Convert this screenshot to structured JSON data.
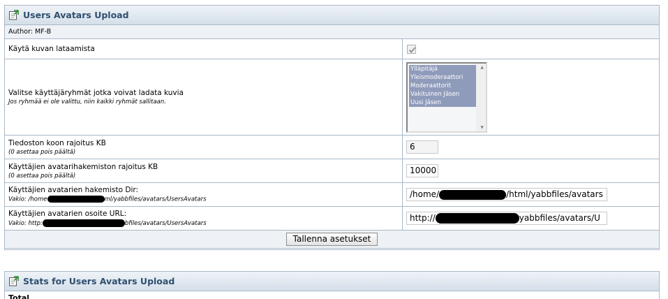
{
  "panel1": {
    "title": "Users Avatars Upload",
    "author": "Author: MF-B",
    "upload": {
      "label": "Käytä kuvan lataamista",
      "checked": true
    },
    "groups": {
      "label": "Valitse käyttäjäryhmät jotka voivat ladata kuvia",
      "sub": "Jos ryhmää ei ole valittu, niin kaikki ryhmät sallitaan.",
      "options": [
        "Ylläpitäjä",
        "Yleismoderaattori",
        "Moderaattorit",
        "Vakituinen Jäsen",
        "Uusi Jäsen"
      ]
    },
    "size": {
      "label": "Tiedoston koon rajoitus KB",
      "sub": "(0 asettaa pois päältä)",
      "value": "6"
    },
    "dirlimit": {
      "label": "Käyttäjien avatarihakemiston rajoitus KB",
      "sub": "(0 asettaa pois päältä)",
      "value": "10000"
    },
    "dir": {
      "label": "Käyttäjien avatarien hakemisto Dir:",
      "sub_start": "Vakio: /home",
      "sub_end": "ml/yabbfiles/avatars/UsersAvatars",
      "value_start": "/home/",
      "value_end": "/html/yabbfiles/avatars"
    },
    "url": {
      "label": "Käyttäjien avatarien osoite URL:",
      "sub_start": "Vakio: http:",
      "sub_end": "bfiles/avatars/UsersAvatars",
      "value_start": "http://",
      "value_end": "yabbfiles/avatars/U"
    },
    "save_label": "Tallenna asetukset"
  },
  "panel2": {
    "title": "Stats for Users Avatars Upload",
    "total_label": "Total"
  },
  "colors": {
    "border": "#a9b8c8",
    "title_text": "#2f4f6f",
    "selection": "#8f9bba"
  }
}
